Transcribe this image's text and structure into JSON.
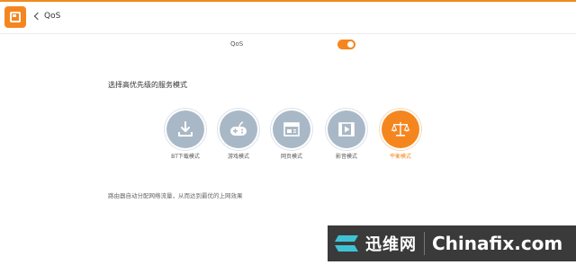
{
  "header": {
    "back_label": "QoS"
  },
  "qos": {
    "label": "QoS",
    "enabled": true
  },
  "section": {
    "title": "选择高优先级的服务模式"
  },
  "modes": [
    {
      "label": "BT下载模式",
      "icon": "download-icon",
      "active": false
    },
    {
      "label": "游戏模式",
      "icon": "gamepad-icon",
      "active": false
    },
    {
      "label": "网页模式",
      "icon": "webpage-icon",
      "active": false
    },
    {
      "label": "影音模式",
      "icon": "video-icon",
      "active": false
    },
    {
      "label": "平衡模式",
      "icon": "balance-scale-icon",
      "active": true
    }
  ],
  "hint": "路由器自动分配网络流量，从而达到最优的上网效果",
  "watermark": {
    "cn": "迅维网",
    "en": "Chinafix.com"
  },
  "colors": {
    "accent": "#f5861f",
    "inactive_mode": "#a9b8c7"
  }
}
